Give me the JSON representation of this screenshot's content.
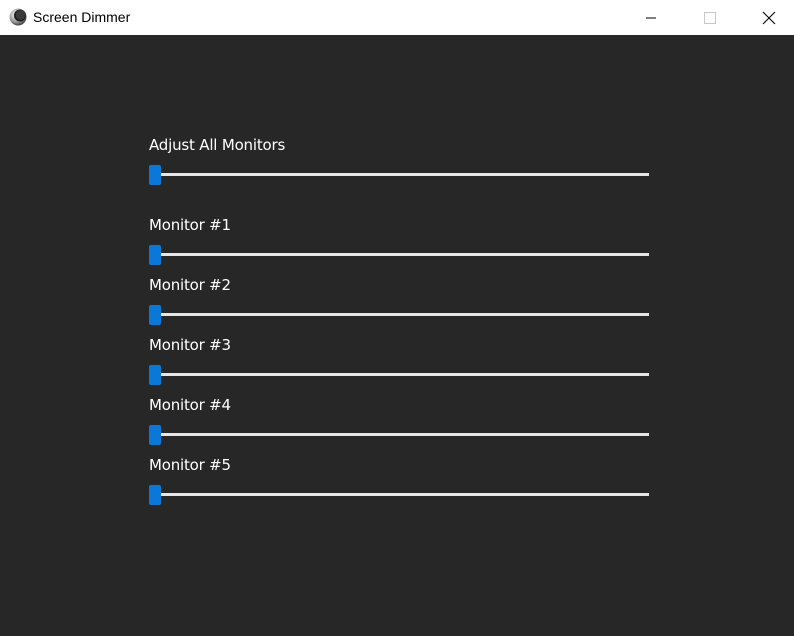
{
  "window": {
    "title": "Screen Dimmer",
    "icons": {
      "app": "moon-icon",
      "minimize": "minimize-icon",
      "maximize": "maximize-icon",
      "close": "close-icon"
    },
    "colors": {
      "background": "#272727",
      "accent": "#0a78d7",
      "track": "#e6e6e6"
    }
  },
  "sliders": [
    {
      "label": "Adjust All Monitors",
      "value": 0
    },
    {
      "label": "Monitor #1",
      "value": 0
    },
    {
      "label": "Monitor #2",
      "value": 0
    },
    {
      "label": "Monitor #3",
      "value": 0
    },
    {
      "label": "Monitor #4",
      "value": 0
    },
    {
      "label": "Monitor #5",
      "value": 0
    }
  ]
}
